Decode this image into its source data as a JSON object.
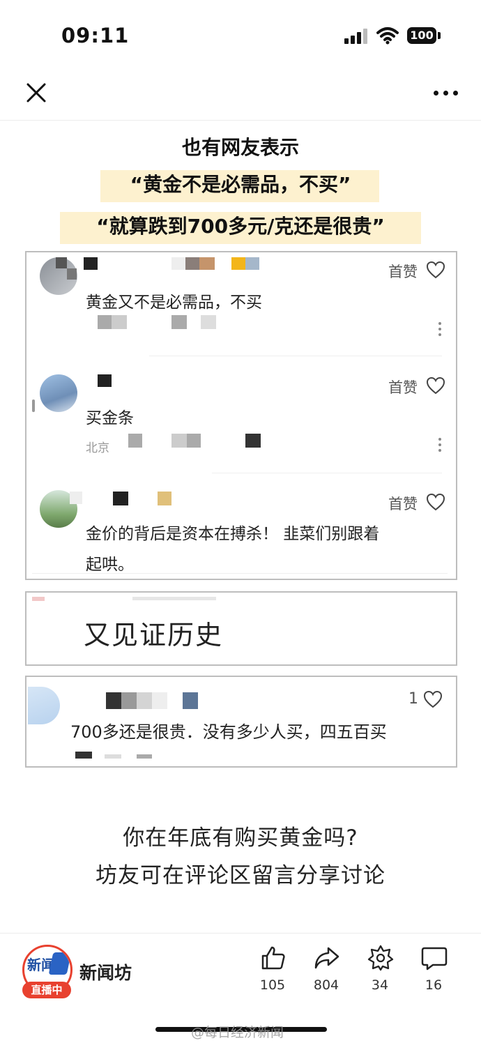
{
  "status_bar": {
    "time": "09:11",
    "battery": "100"
  },
  "headline": {
    "line1": "也有网友表示",
    "line2": "“黄金不是必需品，不买”",
    "line3": "“就算跌到700多元/克还是很贵”",
    "highlight_color": "#fdf1cf"
  },
  "comments": [
    {
      "like_label": "首赞",
      "text": "黄金又不是必需品，不买",
      "location": ""
    },
    {
      "like_label": "首赞",
      "text": "买金条",
      "location": "北京"
    },
    {
      "like_label": "首赞",
      "text_line1": "金价的背后是资本在搏杀！ 韭菜们别跟着",
      "text_line2": "起哄。"
    }
  ],
  "card2": {
    "text": "又见证历史"
  },
  "card3": {
    "like_count": "1",
    "text": "700多还是很贵．没有多少人买，四五百买"
  },
  "question": {
    "line1": "你在年底有购买黄金吗?",
    "line2": "坊友可在评论区留言分享讨论"
  },
  "bottom_bar": {
    "account_name": "新闻坊",
    "live_badge": "直播中",
    "logo_text": "新闻",
    "likes": "105",
    "shares": "804",
    "favorites": "34",
    "comments": "16"
  },
  "watermark": "@每日经济新闻",
  "colors": {
    "accent": "#e8412f",
    "card_border": "#bdbdbd"
  },
  "icons": [
    "close-icon",
    "more-icon",
    "heart-icon",
    "thumbs-up-icon",
    "share-icon",
    "favorite-icon",
    "comment-icon"
  ]
}
